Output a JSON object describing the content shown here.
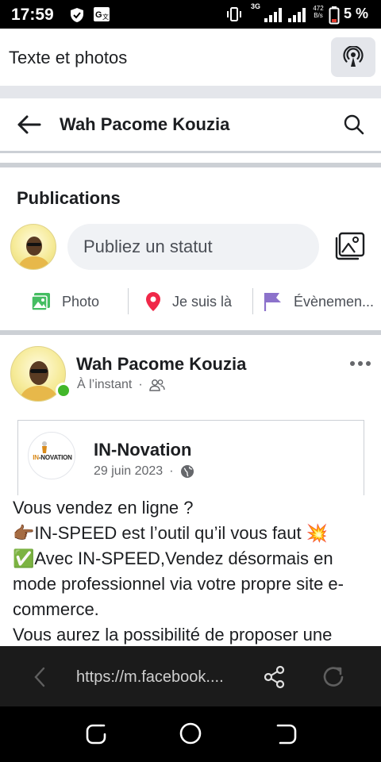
{
  "status_bar": {
    "time": "17:59",
    "network_type": "3G",
    "speed_value": "472",
    "speed_unit": "B/s",
    "battery_percent": "5 %"
  },
  "top_bar": {
    "title": "Texte et photos",
    "icon": "podcast-icon"
  },
  "profile_header": {
    "name": "Wah Pacome Kouzia",
    "back_icon": "arrow-left-icon",
    "search_icon": "search-icon"
  },
  "publications": {
    "title": "Publications",
    "status_placeholder": "Publiez un statut",
    "actions": [
      {
        "label": "Photo",
        "icon": "photo-icon",
        "color": "#45bd62"
      },
      {
        "label": "Je suis là",
        "icon": "location-pin-icon",
        "color": "#f02849"
      },
      {
        "label": "Évènemen...",
        "icon": "flag-icon",
        "color": "#8c72cb"
      }
    ]
  },
  "post": {
    "author": "Wah Pacome Kouzia",
    "time": "À l’instant",
    "audience_icon": "friends-icon",
    "online_color": "#42b72a",
    "shared": {
      "page_name": "IN-Novation",
      "logo_text_in": "IN",
      "logo_text_rest": "-NOVATION",
      "date": "29 juin 2023",
      "audience_icon": "globe-icon"
    },
    "body_lines": [
      "Vous vendez en ligne ?",
      "👉🏾IN-SPEED est l’outil qu’il vous faut 💥",
      "✅Avec IN-SPEED,Vendez désormais en",
      "mode professionnel via votre propre site e-",
      "commerce.",
      "Vous aurez la possibilité de proposer une"
    ]
  },
  "browser_bar": {
    "url": "https://m.facebook...."
  },
  "colors": {
    "accent_green": "#42b72a",
    "divider": "#ccd0d5",
    "input_bg": "#f0f2f5"
  }
}
